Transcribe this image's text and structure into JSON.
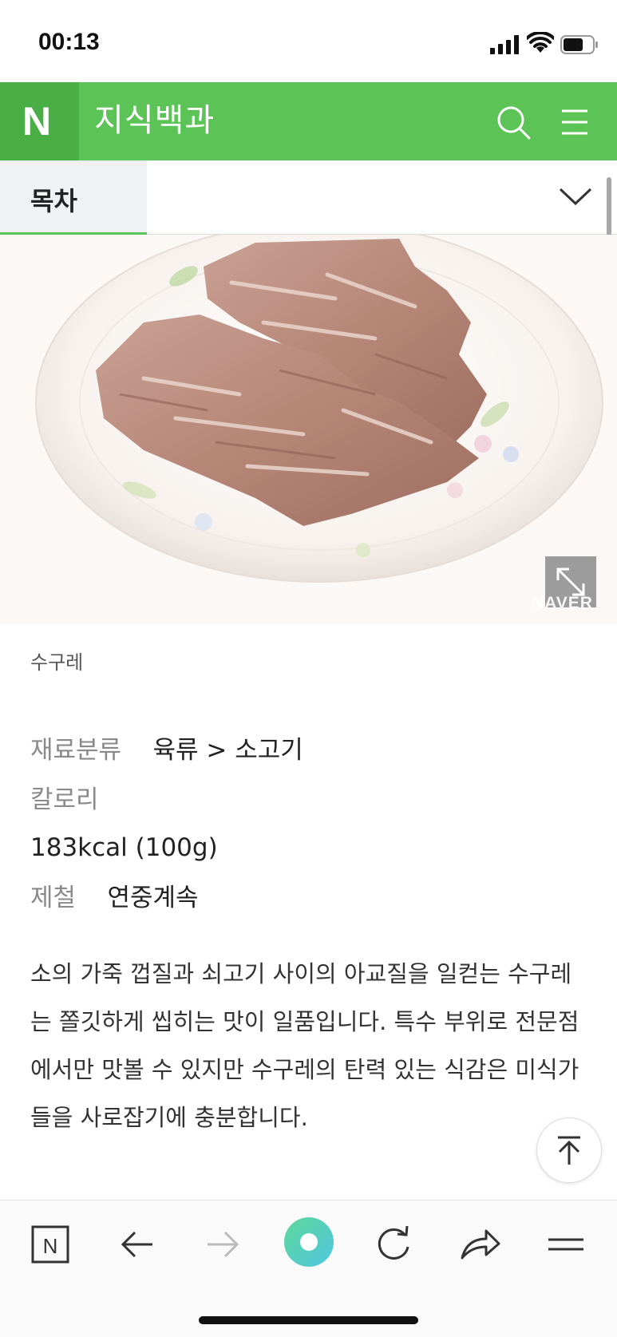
{
  "status_bar": {
    "time": "00:13"
  },
  "header": {
    "logo": "N",
    "title": "지식백과",
    "icons": [
      "search-icon",
      "hamburger-menu-icon"
    ]
  },
  "toc": {
    "label": "목차"
  },
  "image": {
    "watermark": "NAVER",
    "expand_icon": "expand-icon"
  },
  "caption": "수구레",
  "info": {
    "category_label": "재료분류",
    "category_value": "육류 > 소고기",
    "calorie_label": "칼로리",
    "calorie_value": "183kcal (100g)",
    "season_label": "제철",
    "season_value": "연중계속"
  },
  "description": "소의 가죽 껍질과 쇠고기 사이의 아교질을 일컫는 수구레는 쫄깃하게 씹히는 맛이 일품입니다. 특수 부위로 전문점에서만 맛볼 수 있지만 수구레의 탄력 있는 식감은 미식가들을 사로잡기에 충분합니다.",
  "toolbar": {
    "home_label": "N"
  },
  "colors": {
    "brand_green": "#5cc456",
    "logo_green": "#4aae46",
    "accent_gradient_start": "#5ed89a",
    "accent_gradient_end": "#4fc6e0"
  }
}
